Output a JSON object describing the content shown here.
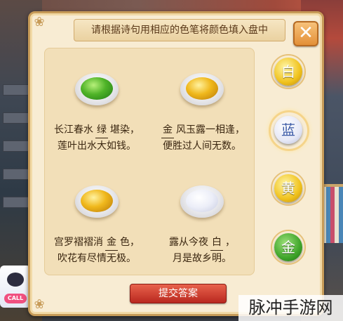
{
  "dialog": {
    "instruction": "请根据诗句用相应的色笔将颜色填入盘中",
    "close_glyph": "✕",
    "submit_label": "提交答案"
  },
  "poems": [
    {
      "line1_pre": "长江春水",
      "answer": "绿",
      "line1_post": "堪染，",
      "line2": "莲叶出水大如钱。",
      "paint_color": "#4fb328"
    },
    {
      "line1_pre": "",
      "answer": "金",
      "line1_post": "风玉露一相逢，",
      "line2": "便胜过人间无数。",
      "paint_color": "#f0b81c"
    },
    {
      "line1_pre": "宫罗褶褶消",
      "answer": "金",
      "line1_post": "色，",
      "line2": "吹花有尽情无极。",
      "paint_color": "#f0b81c"
    },
    {
      "line1_pre": "露从今夜",
      "answer": "白",
      "line1_post": "，",
      "line2": "月是故乡明。",
      "paint_color": "#eceef8"
    }
  ],
  "color_pens": [
    {
      "label": "白",
      "selected": false
    },
    {
      "label": "蓝",
      "selected": true
    },
    {
      "label": "黄",
      "selected": false
    },
    {
      "label": "金",
      "selected": false
    }
  ],
  "overlay": {
    "watermark": "脉冲手游网",
    "avatar_badge": "CALL"
  }
}
